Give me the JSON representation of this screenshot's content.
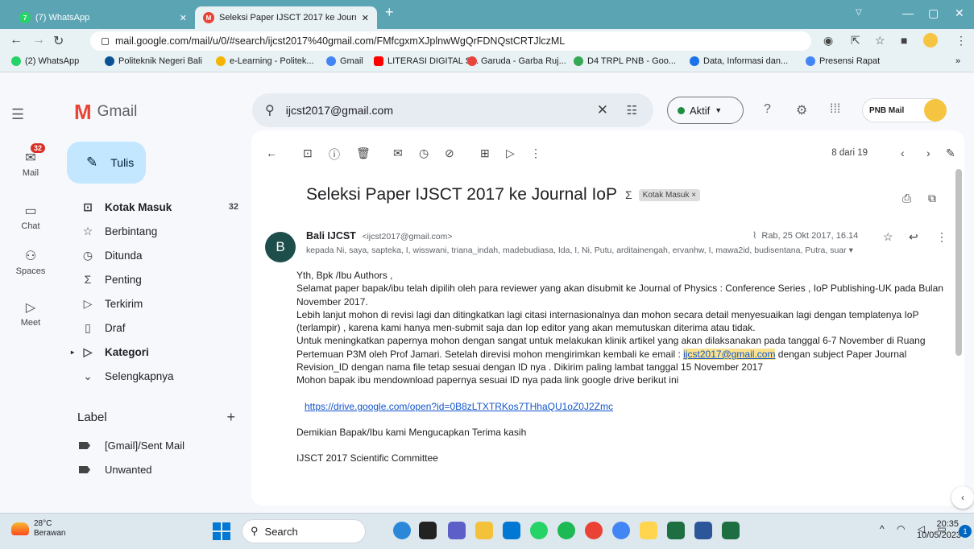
{
  "browser": {
    "tabs": [
      {
        "label": "(7) WhatsApp",
        "color": "#25d366",
        "badge": "7"
      },
      {
        "label": "Seleksi Paper IJSCT 2017 ke Journ",
        "color": "#ea4335",
        "badge": "M"
      }
    ],
    "new_tab": "+",
    "url": "mail.google.com/mail/u/0/#search/ijcst2017%40gmail.com/FMfcgxmXJplnwWgQrFDNQstCRTJlczML",
    "bookmarks": [
      {
        "label": "(2) WhatsApp",
        "color": "#25d366"
      },
      {
        "label": "Politeknik Negeri Bali",
        "color": "#0b5394"
      },
      {
        "label": "e-Learning - Politek...",
        "color": "#f4b400"
      },
      {
        "label": "Gmail",
        "color": "#4285f4"
      },
      {
        "label": "LITERASI DIGITAL S...",
        "color": "#ff0000"
      },
      {
        "label": "Garuda - Garba Ruj...",
        "color": "#e8453c"
      },
      {
        "label": "D4 TRPL PNB - Goo...",
        "color": "#34a853"
      },
      {
        "label": "Data, Informasi dan...",
        "color": "#1a73e8"
      },
      {
        "label": "Presensi Rapat",
        "color": "#4285f4"
      }
    ],
    "more_bookmarks": "»"
  },
  "gmail": {
    "brand": "Gmail",
    "search_query": "ijcst2017@gmail.com",
    "status": "Aktif",
    "account_label": "PNB Mail",
    "rail": [
      {
        "label": "Mail",
        "badge": "32"
      },
      {
        "label": "Chat"
      },
      {
        "label": "Spaces"
      },
      {
        "label": "Meet"
      }
    ],
    "compose": "Tulis",
    "nav": [
      {
        "label": "Kotak Masuk",
        "count": "32"
      },
      {
        "label": "Berbintang"
      },
      {
        "label": "Ditunda"
      },
      {
        "label": "Penting"
      },
      {
        "label": "Terkirim"
      },
      {
        "label": "Draf"
      },
      {
        "label": "Kategori"
      },
      {
        "label": "Selengkapnya"
      }
    ],
    "labels_heading": "Label",
    "labels": [
      "[Gmail]/Sent Mail",
      "Unwanted"
    ],
    "pager": "8 dari 19"
  },
  "email": {
    "subject": "Seleksi Paper IJSCT 2017 ke Journal IoP",
    "folder_chip": "Kotak Masuk",
    "avatar_letter": "B",
    "sender_name": "Bali IJCST",
    "sender_email": "<ijcst2017@gmail.com>",
    "date": "Rab, 25 Okt 2017, 16.14",
    "recipients": "kepada Ni, saya, sapteka, I, wisswani, triana_indah, madebudiasa, Ida, I, Ni, Putu, arditainengah, ervanhw, I, mawa2id, budisentana, Putra, suar",
    "greeting": "Yth, Bpk /Ibu Authors ,",
    "p1": "Selamat paper bapak/ibu telah dipilih  oleh para reviewer  yang akan disubmit  ke Journal of Physics : Conference Series , IoP Publishing-UK pada  Bulan November 2017.",
    "p2": "Lebih lanjut mohon di revisi lagi dan ditingkatkan lagi citasi  internasionalnya dan mohon secara detail menyesuaikan lagi dengan templatenya IoP (terlampir) , karena kami hanya men-submit saja dan Iop editor  yang akan memutuskan diterima atau tidak.",
    "p3_before": "Untuk meningkatkan papernya mohon dengan sangat untuk  melakukan klinik artikel yang akan dilaksanakan pada tanggal 6-7 November di Ruang Pertemuan  P3M oleh Prof Jamari. Setelah direvisi mohon mengirimkan kembali ke email : ",
    "p3_email": "ijcst2017@gmail.com",
    "p3_after": " dengan subject Paper Journal Revision_ID dengan nama file tetap sesuai dengan ID nya . Dikirim paling lambat tanggal 15 November 2017",
    "p4": "Mohon bapak ibu mendownload papernya sesuai ID nya pada link google drive berikut ini",
    "link": "https://drive.google.com/open?id=0B8zLTXTRKos7THhaQU1oZ0J2Zmc",
    "closing": "Demikian Bapak/Ibu kami Mengucapkan Terima kasih",
    "signature": "IJSCT 2017 Scientific Committee"
  },
  "taskbar": {
    "temp": "28°C",
    "weather": "Berawan",
    "search": "Search",
    "time": "20:35",
    "date": "10/05/2023",
    "notif_count": "1"
  }
}
